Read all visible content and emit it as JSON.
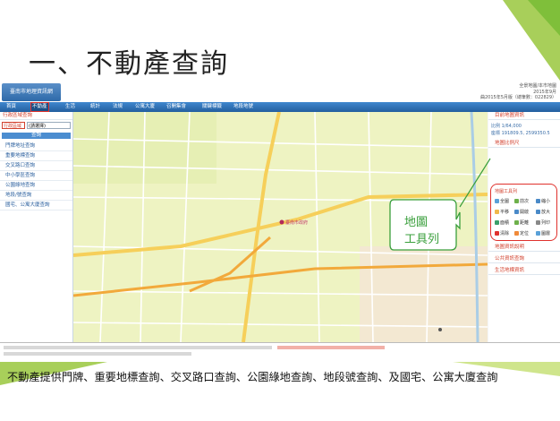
{
  "slide": {
    "title": "一、不動產查詢",
    "callout": "地圖\n工具列",
    "caption": "不動產提供門牌、重要地標查詢、交叉路口查詢、公園綠地查詢、地段號查詢、及國宅、公寓大廈查詢"
  },
  "app": {
    "nav": [
      "首頁",
      "不動產",
      "生活",
      "統計",
      "法規",
      "公寓大廈",
      "召開集會",
      "關鍵標籤",
      "地段地號"
    ],
    "active_nav": "不動產",
    "top_info": [
      "全景地圖/本市地圖",
      "2015年9月",
      "曲2015年5月版（總筆數：022829）"
    ],
    "left_panel": {
      "section_title": "行政區域查詢",
      "district_label": "行政區域",
      "district_value": "(請選擇)",
      "query_button": "查詢",
      "items": [
        "門牌地址查詢",
        "重要地標查詢",
        "交叉路口查詢",
        "中小學區查詢",
        "公園綠地查詢",
        "地段/號查詢",
        "國宅、公寓大廈查詢"
      ]
    },
    "right_panel": {
      "section1": "目前地圖資訊",
      "scale": "比例 1/64,000",
      "coords": "座標 191809.5, 2599350.5",
      "section2": "地圖比例尺",
      "tools_title": "地圖工具列",
      "tools": [
        "全圖",
        "前次",
        "縮小",
        "平移",
        "開啟",
        "放大",
        "面積",
        "距離",
        "列印",
        "清除",
        "定位",
        "圖層"
      ],
      "section3": "地圖資訊說明",
      "section4": "公共資訊查詢",
      "section5": "生活地標資訊"
    },
    "map_label": "臺南市政府"
  },
  "colors": {
    "nav": "#2d6fb4",
    "highlight": "#e0322d",
    "callout": "#3a9f3c"
  }
}
